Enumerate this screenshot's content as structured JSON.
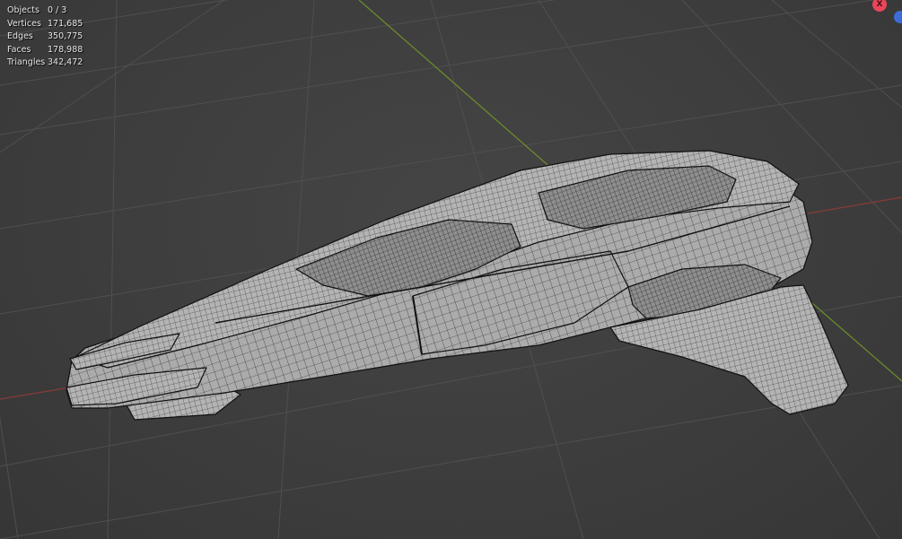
{
  "viewport": {
    "name": "3D Viewport",
    "shading": "wireframe"
  },
  "statistics": {
    "rows": [
      {
        "label": "Objects",
        "value": "0 / 3"
      },
      {
        "label": "Vertices",
        "value": "171,685"
      },
      {
        "label": "Edges",
        "value": "350,775"
      },
      {
        "label": "Faces",
        "value": "178,988"
      },
      {
        "label": "Triangles",
        "value": "342,472"
      }
    ]
  },
  "gizmo": {
    "x_label": "X",
    "x_color": "#e8465a",
    "z_color": "#3d6bd8"
  },
  "colors": {
    "background": "#3d3d3d",
    "grid": "#4f4f4f",
    "x_axis": "#8a3a3a",
    "y_axis": "#6a8a2a",
    "mesh_fill": "#a9a9a9",
    "mesh_wire": "#1a1a1a"
  }
}
